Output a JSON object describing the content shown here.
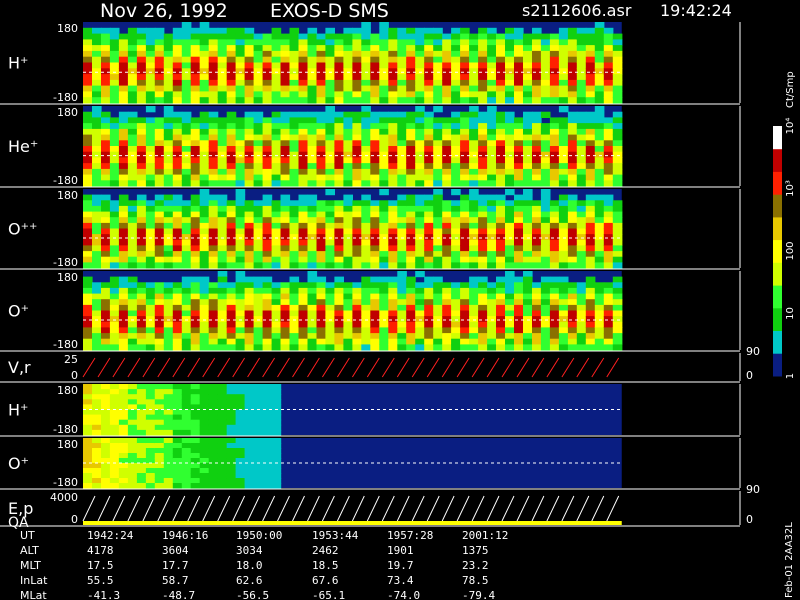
{
  "header": {
    "date": "Nov 26, 1992",
    "mission": "EXOS-D SMS",
    "file": "s2112606.asr",
    "time": "19:42:24"
  },
  "colorbar": {
    "label": "Ct/Smp",
    "ticks": [
      {
        "label": "1",
        "value": 1
      },
      {
        "label": "10",
        "value": 10
      },
      {
        "label": "100",
        "value": 100
      },
      {
        "label": "10³",
        "value": 1000
      },
      {
        "label": "10⁴",
        "value": 10000
      }
    ],
    "colors": [
      "#0a1e82",
      "#00c8c8",
      "#10d010",
      "#30ff30",
      "#d0ff00",
      "#ffff00",
      "#e8c800",
      "#8a7000",
      "#ff2000",
      "#c00000",
      "#ffffff"
    ]
  },
  "footer": {
    "id": "Feb-01 2AA32L",
    "row_labels": [
      "UT",
      "ALT",
      "MLT",
      "InLat",
      "MLat"
    ],
    "columns": [
      {
        "UT": "1942:24",
        "ALT": "4178",
        "MLT": "17.5",
        "InLat": "55.5",
        "MLat": "-41.3"
      },
      {
        "UT": "1946:16",
        "ALT": "3604",
        "MLT": "17.7",
        "InLat": "58.7",
        "MLat": "-48.7"
      },
      {
        "UT": "1950:00",
        "ALT": "3034",
        "MLT": "18.0",
        "InLat": "62.6",
        "MLat": "-56.5"
      },
      {
        "UT": "1953:44",
        "ALT": "2462",
        "MLT": "18.5",
        "InLat": "67.6",
        "MLat": "-65.1"
      },
      {
        "UT": "1957:28",
        "ALT": "1901",
        "MLT": "19.7",
        "InLat": "73.4",
        "MLat": "-74.0"
      },
      {
        "UT": "2001:12",
        "ALT": "1375",
        "MLT": "23.2",
        "InLat": "78.5",
        "MLat": "-79.4"
      }
    ]
  },
  "chart_data": [
    {
      "type": "heatmap",
      "panel": "H⁺",
      "yticks": [
        "180",
        "-180"
      ],
      "time_range": [
        "1942:24",
        "2001:12"
      ],
      "data_end_fraction": 0.82
    },
    {
      "type": "heatmap",
      "panel": "He⁺",
      "yticks": [
        "180",
        "-180"
      ]
    },
    {
      "type": "heatmap",
      "panel": "O⁺⁺",
      "yticks": [
        "180",
        "-180"
      ]
    },
    {
      "type": "heatmap",
      "panel": "O⁺",
      "yticks": [
        "180",
        "-180"
      ]
    },
    {
      "type": "line",
      "panel": "V,r",
      "yticks": [
        "25",
        "0"
      ],
      "right_ticks": [
        "90",
        "0"
      ]
    },
    {
      "type": "heatmap",
      "panel": "H⁺",
      "yticks": [
        "180",
        "-180"
      ]
    },
    {
      "type": "heatmap",
      "panel": "O⁺",
      "yticks": [
        "180",
        "-180"
      ]
    },
    {
      "type": "line",
      "panel": "E,p",
      "subpanel": "QA",
      "yticks": [
        "4000",
        "0"
      ],
      "right_ticks": [
        "90",
        "0"
      ]
    }
  ]
}
